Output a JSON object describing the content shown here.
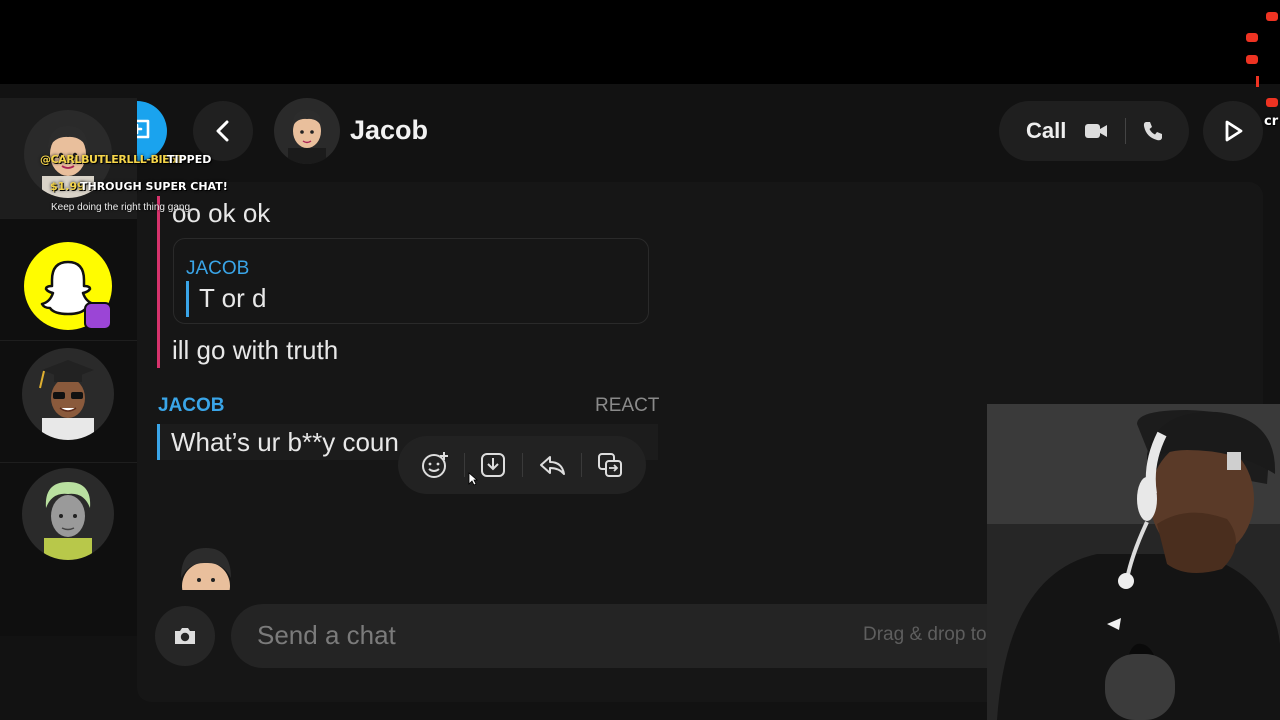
{
  "header": {
    "contact_name": "Jacob",
    "call_label": "Call"
  },
  "messages": {
    "msg1": "oo ok ok",
    "quote_sender": "JACOB",
    "quote_text": "T or d",
    "msg2": "ill go with truth",
    "sender": "JACOB",
    "react_label": "REACT",
    "msg3": "What’s ur b**y coun"
  },
  "composer": {
    "placeholder": "Send a chat",
    "drag_hint": "Drag & drop to"
  },
  "overlay": {
    "username": "@CARLBUTLERLLL-BIE5P",
    "tipped": "TIPPED",
    "amount": "$1.99",
    "through": "THROUGH SUPER CHAT!",
    "message": "Keep doing the right thing gang",
    "side_fragment": "cr"
  },
  "colors": {
    "accent_blue": "#3aa5e8",
    "my_message_bar": "#d6336c",
    "snapchat_yellow": "#fffc00",
    "badge_purple": "#9b45d6"
  },
  "icons": [
    "gear-icon",
    "new-chat-icon",
    "chevron-left-icon",
    "video-icon",
    "phone-icon",
    "play-icon",
    "emoji-add-icon",
    "save-icon",
    "reply-icon",
    "copy-icon",
    "camera-icon",
    "ghost-icon"
  ]
}
